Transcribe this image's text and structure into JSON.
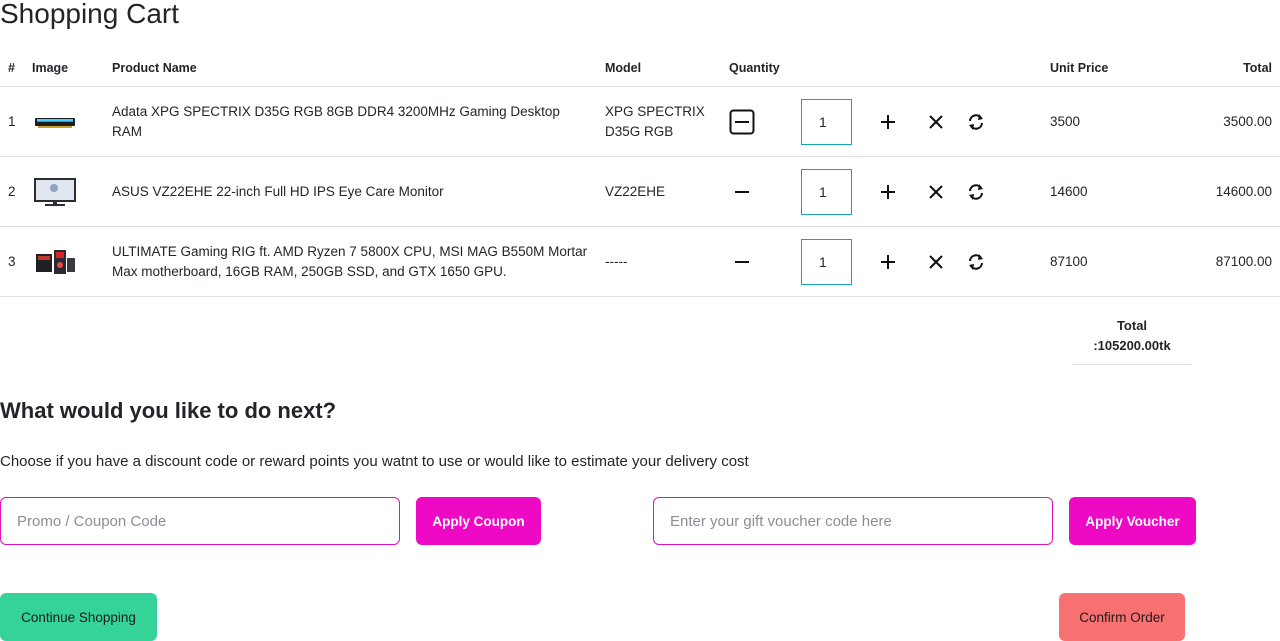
{
  "page": {
    "title": "Shopping Cart"
  },
  "table": {
    "headers": {
      "num": "#",
      "image": "Image",
      "name": "Product Name",
      "model": "Model",
      "quantity": "Quantity",
      "unit_price": "Unit Price",
      "total": "Total"
    },
    "rows": [
      {
        "num": "1",
        "name": "Adata XPG SPECTRIX D35G RGB 8GB DDR4 3200MHz Gaming Desktop RAM",
        "model": "XPG SPECTRIX D35G RGB",
        "quantity": "1",
        "unit_price": "3500",
        "total": "3500.00",
        "thumb_icon": "ram-stick-thumbnail"
      },
      {
        "num": "2",
        "name": "ASUS VZ22EHE 22-inch Full HD IPS Eye Care Monitor",
        "model": "VZ22EHE",
        "quantity": "1",
        "unit_price": "14600",
        "total": "14600.00",
        "thumb_icon": "monitor-thumbnail"
      },
      {
        "num": "3",
        "name": "ULTIMATE Gaming RIG ft. AMD Ryzen 7 5800X CPU, MSI MAG B550M Mortar Max motherboard, 16GB RAM, 250GB SSD, and GTX 1650 GPU.",
        "model": "-----",
        "quantity": "1",
        "unit_price": "87100",
        "total": "87100.00",
        "thumb_icon": "pc-rig-thumbnail"
      }
    ]
  },
  "summary": {
    "total_label": "Total",
    "total_value": ":105200.00tk"
  },
  "next": {
    "heading": "What would you like to do next?",
    "description": "Choose if you have a discount code or reward points you watnt to use or would like to estimate your delivery cost"
  },
  "coupon": {
    "placeholder": "Promo / Coupon Code",
    "button": "Apply Coupon"
  },
  "voucher": {
    "placeholder": "Enter your gift voucher code here",
    "button": "Apply Voucher"
  },
  "actions": {
    "continue": "Continue Shopping",
    "confirm": "Confirm Order"
  },
  "colors": {
    "accent_pink": "#ee09c4",
    "input_border_pink": "#e011c0",
    "continue_green": "#35d399",
    "confirm_red": "#f87171",
    "qty_border_teal": "#17a2b8"
  },
  "icons": {
    "minus": "minus-icon",
    "plus": "plus-icon",
    "remove": "close-icon",
    "update": "refresh-icon"
  }
}
